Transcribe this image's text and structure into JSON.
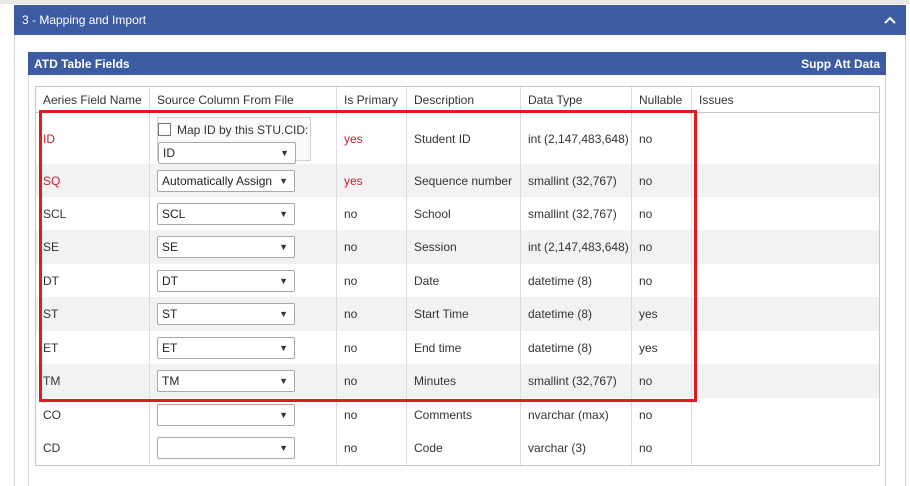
{
  "section": {
    "title": "3 - Mapping and Import",
    "collapse_icon": "chevron-up-icon"
  },
  "panel": {
    "title": "ATD Table Fields",
    "supp_link": "Supp Att Data"
  },
  "columns": [
    "Aeries Field Name",
    "Source Column From File",
    "Is Primary",
    "Description",
    "Data Type",
    "Nullable",
    "Issues"
  ],
  "map_checkbox_label": "Map ID by this STU.CID:",
  "rows": [
    {
      "field": "ID",
      "source": "ID",
      "primary": "yes",
      "description": "Student ID",
      "datatype": "int (2,147,483,648)",
      "nullable": "no",
      "issues": ""
    },
    {
      "field": "SQ",
      "source": "Automatically Assign",
      "primary": "yes",
      "description": "Sequence number",
      "datatype": "smallint (32,767)",
      "nullable": "no",
      "issues": ""
    },
    {
      "field": "SCL",
      "source": "SCL",
      "primary": "no",
      "description": "School",
      "datatype": "smallint (32,767)",
      "nullable": "no",
      "issues": ""
    },
    {
      "field": "SE",
      "source": "SE",
      "primary": "no",
      "description": "Session",
      "datatype": "int (2,147,483,648)",
      "nullable": "no",
      "issues": ""
    },
    {
      "field": "DT",
      "source": "DT",
      "primary": "no",
      "description": "Date",
      "datatype": "datetime (8)",
      "nullable": "no",
      "issues": ""
    },
    {
      "field": "ST",
      "source": "ST",
      "primary": "no",
      "description": "Start Time",
      "datatype": "datetime (8)",
      "nullable": "yes",
      "issues": ""
    },
    {
      "field": "ET",
      "source": "ET",
      "primary": "no",
      "description": "End time",
      "datatype": "datetime (8)",
      "nullable": "yes",
      "issues": ""
    },
    {
      "field": "TM",
      "source": "TM",
      "primary": "no",
      "description": "Minutes",
      "datatype": "smallint (32,767)",
      "nullable": "no",
      "issues": ""
    },
    {
      "field": "CO",
      "source": "",
      "primary": "no",
      "description": "Comments",
      "datatype": "nvarchar (max)",
      "nullable": "no",
      "issues": ""
    },
    {
      "field": "CD",
      "source": "",
      "primary": "no",
      "description": "Code",
      "datatype": "varchar (3)",
      "nullable": "no",
      "issues": ""
    }
  ],
  "colors": {
    "header_blue": "#3d5ba1",
    "primary_red": "#c8202a",
    "highlight_red": "#e11a1f"
  }
}
